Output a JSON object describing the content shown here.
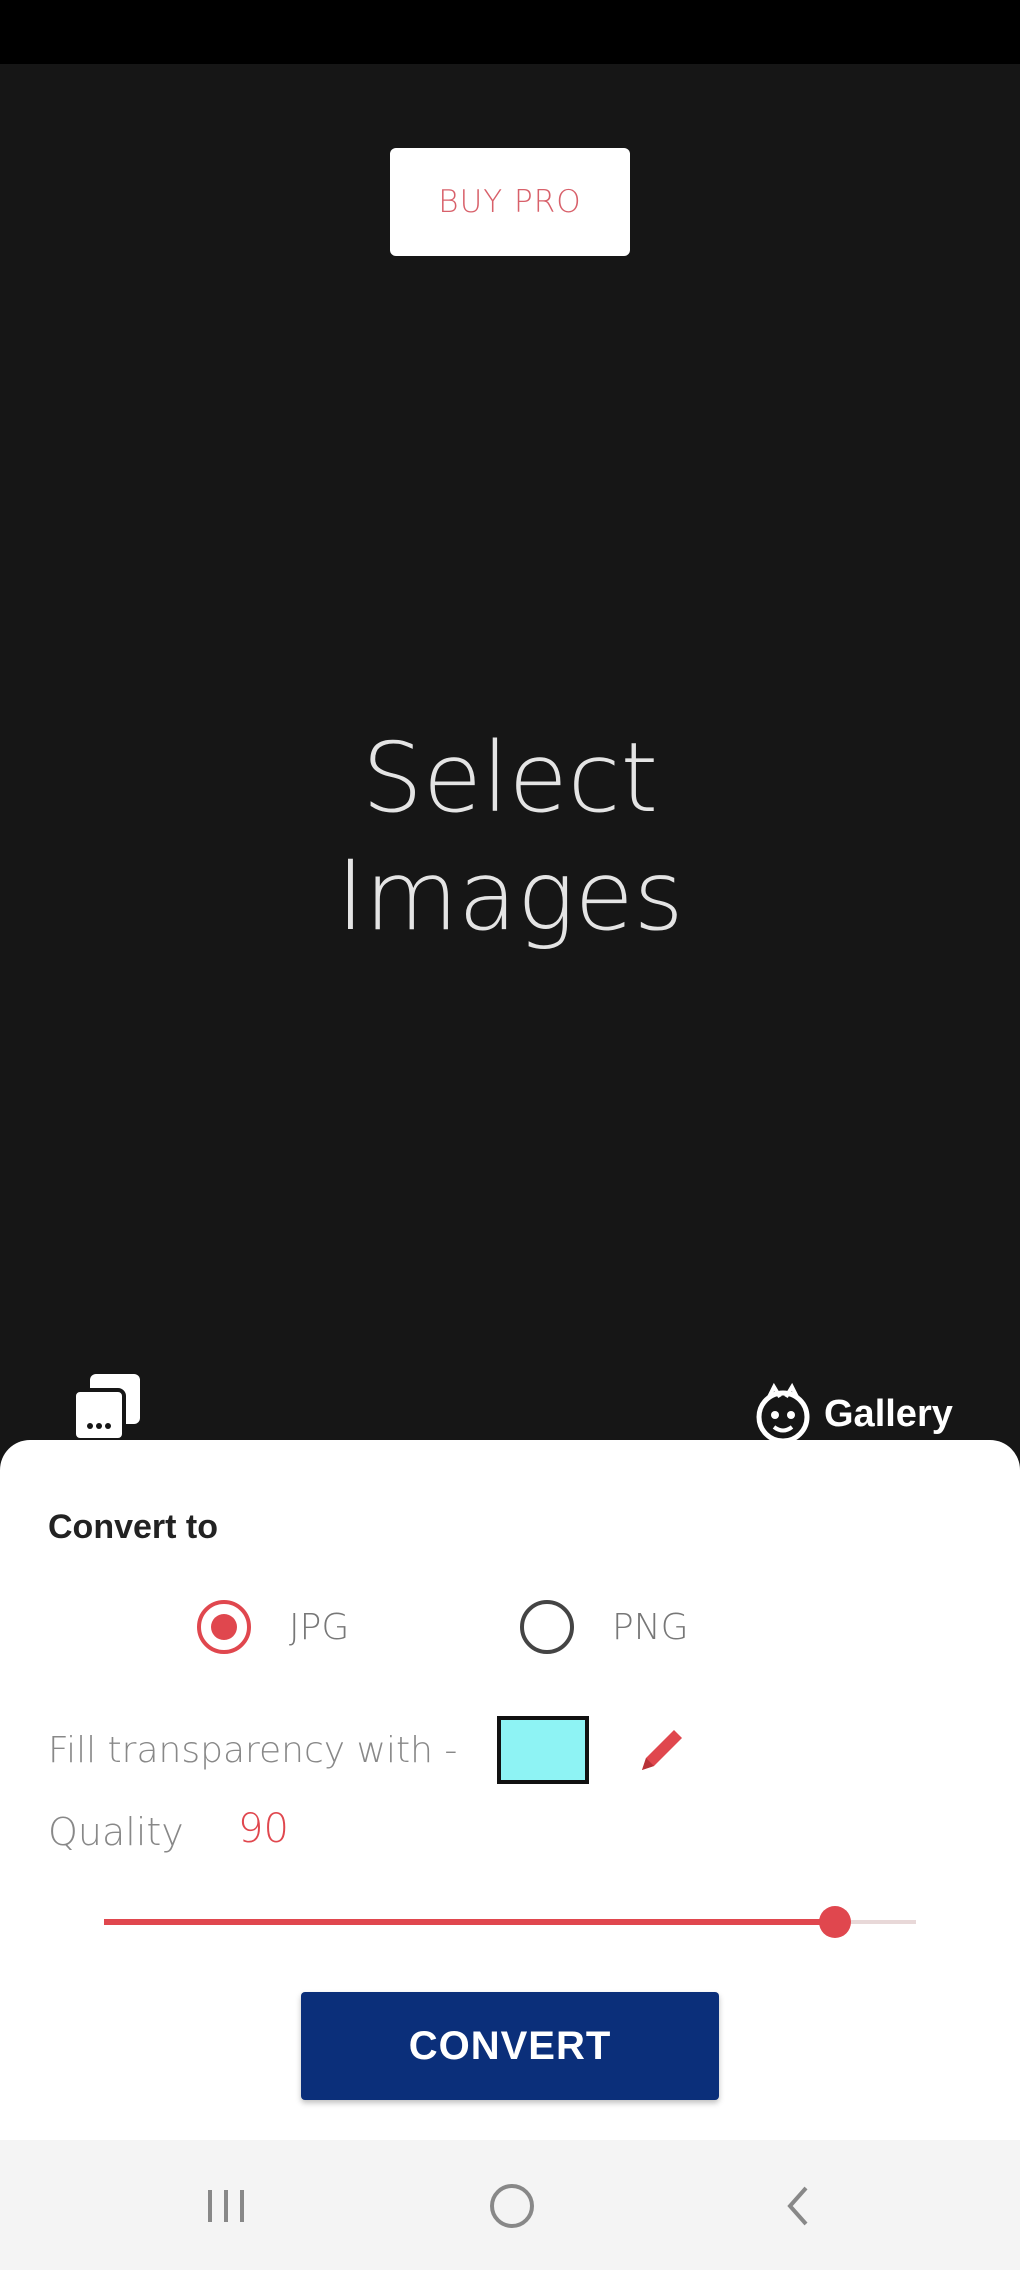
{
  "header": {
    "buy_pro_label": "BUY PRO"
  },
  "main": {
    "title_line1": "Select",
    "title_line2": "Images",
    "gallery_label": "Gallery",
    "icons": {
      "left": "gallery-photos-icon",
      "right": "gallery-app-icon"
    }
  },
  "sheet": {
    "convert_to_label": "Convert to",
    "formats": [
      {
        "label": "JPG",
        "selected": true
      },
      {
        "label": "PNG",
        "selected": false
      }
    ],
    "fill_label": "Fill transparency with -",
    "fill_color": "#8ef3f4",
    "quality_label": "Quality",
    "quality_value": "90",
    "quality_level": 90,
    "convert_label": "CONVERT"
  },
  "colors": {
    "accent": "#e0474e",
    "primary_button": "#0b2f7a",
    "background": "#161616"
  }
}
